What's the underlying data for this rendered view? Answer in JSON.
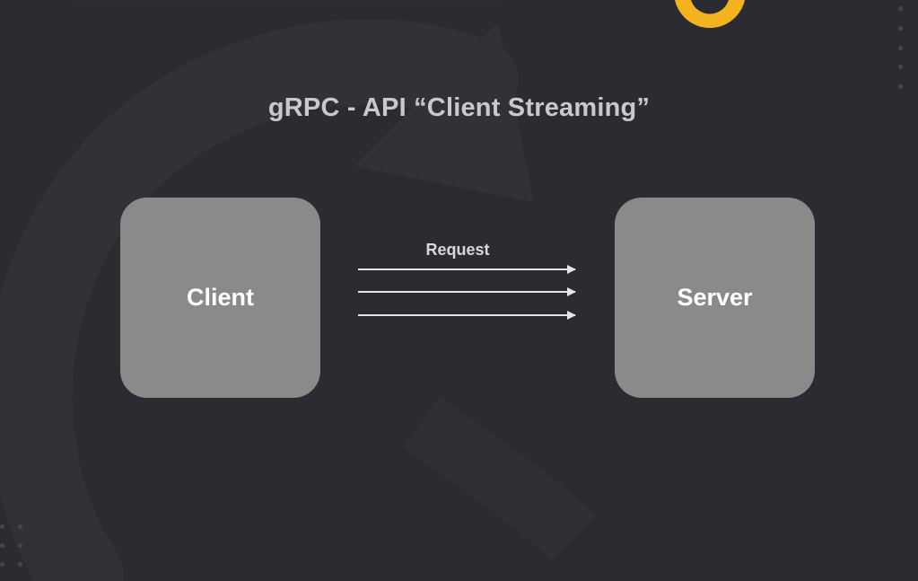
{
  "slide": {
    "title": "gRPC - API “Client Streaming”"
  },
  "diagram": {
    "client_label": "Client",
    "server_label": "Server",
    "arrow_label": "Request",
    "arrow_count": 3,
    "colors": {
      "background": "#2a2c31",
      "node_fill": "#8a8a8a",
      "arrow": "#e6e6e6",
      "logo_accent": "#f2b31e"
    }
  },
  "icons": {
    "logo": "partial-yellow-logo-icon"
  }
}
